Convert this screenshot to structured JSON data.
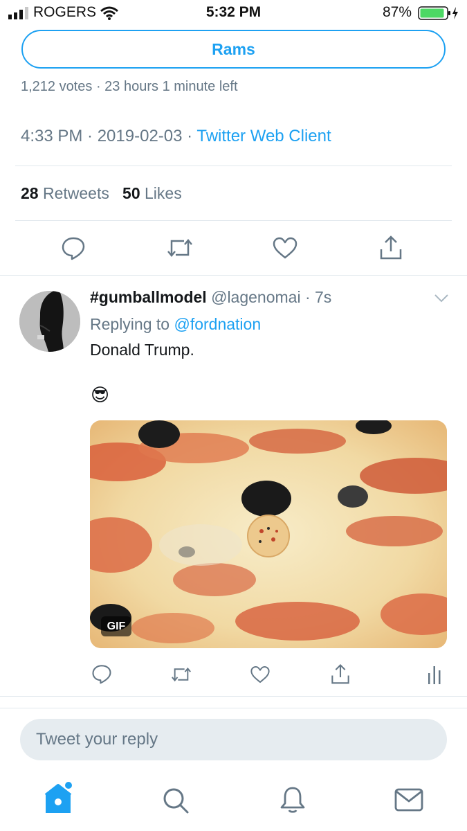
{
  "status_bar": {
    "carrier": "ROGERS",
    "time": "5:32 PM",
    "battery": "87%"
  },
  "poll": {
    "option_label": "Rams",
    "meta": "1,212 votes · 23 hours 1 minute left"
  },
  "tweet_meta": {
    "time": "4:33 PM · 2019-02-03 · ",
    "client": "Twitter Web Client"
  },
  "stats": {
    "retweets_count": "28",
    "retweets_label": "Retweets",
    "likes_count": "50",
    "likes_label": "Likes"
  },
  "reply_tweet": {
    "name": "#gumballmodel",
    "handle": "@lagenomai · 7s",
    "replying_prefix": "Replying to ",
    "replying_to": "@fordnation",
    "text": "Donald Trump.",
    "emoji": "😎",
    "gif_label": "GIF"
  },
  "composer": {
    "placeholder": "Tweet your reply"
  },
  "colors": {
    "accent": "#1da1f2",
    "secondary_text": "#657786",
    "divider": "#e1e8ed"
  },
  "icons": [
    "signal-icon",
    "wifi-icon",
    "battery-icon",
    "reply-icon",
    "retweet-icon",
    "like-icon",
    "share-icon",
    "chevron-down-icon",
    "analytics-icon",
    "home-icon",
    "search-icon",
    "notifications-icon",
    "messages-icon"
  ]
}
